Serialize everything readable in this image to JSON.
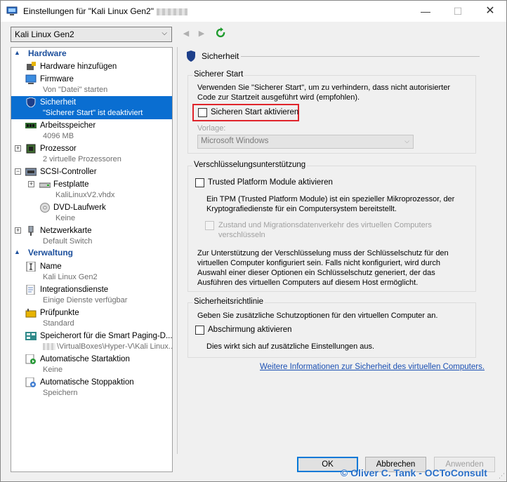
{
  "window": {
    "title": "Einstellungen für \"Kali Linux Gen2\"",
    "controls": {
      "minimize": "—",
      "maximize": "☐",
      "close": "✕"
    }
  },
  "vm_selector": {
    "value": "Kali Linux Gen2"
  },
  "tree": {
    "hardware_header": "Hardware",
    "management_header": "Verwaltung",
    "items": [
      {
        "icon": "hardware-add-icon",
        "label": "Hardware hinzufügen",
        "sub": ""
      },
      {
        "icon": "firmware-icon",
        "label": "Firmware",
        "sub": "Von \"Datei\" starten"
      },
      {
        "icon": "shield-icon",
        "label": "Sicherheit",
        "sub": "\"Sicherer Start\" ist deaktiviert"
      },
      {
        "icon": "memory-icon",
        "label": "Arbeitsspeicher",
        "sub": "4096 MB"
      },
      {
        "icon": "processor-icon",
        "label": "Prozessor",
        "sub": "2 virtuelle Prozessoren"
      },
      {
        "icon": "scsi-controller-icon",
        "label": "SCSI-Controller",
        "sub": ""
      },
      {
        "icon": "hard-disk-icon",
        "label": "Festplatte",
        "sub": "KaliLinuxV2.vhdx"
      },
      {
        "icon": "dvd-drive-icon",
        "label": "DVD-Laufwerk",
        "sub": "Keine"
      },
      {
        "icon": "network-adapter-icon",
        "label": "Netzwerkkarte",
        "sub": "Default Switch"
      },
      {
        "icon": "name-icon",
        "label": "Name",
        "sub": "Kali Linux Gen2"
      },
      {
        "icon": "integration-services-icon",
        "label": "Integrationsdienste",
        "sub": "Einige Dienste verfügbar"
      },
      {
        "icon": "checkpoints-icon",
        "label": "Prüfpunkte",
        "sub": "Standard"
      },
      {
        "icon": "smart-paging-icon",
        "label": "Speicherort für die Smart Paging-D...",
        "sub": "\\VirtualBoxes\\Hyper-V\\Kali Linux..."
      },
      {
        "icon": "auto-start-icon",
        "label": "Automatische Startaktion",
        "sub": "Keine"
      },
      {
        "icon": "auto-stop-icon",
        "label": "Automatische Stoppaktion",
        "sub": "Speichern"
      }
    ]
  },
  "content": {
    "header": "Sicherheit",
    "secure_boot": {
      "title": "Sicherer Start",
      "description_line1": "Verwenden Sie \"Sicherer Start\", um zu verhindern, dass nicht autorisierter",
      "description_line2": "Code zur Startzeit ausgeführt wird (empfohlen).",
      "checkbox_label": "Sicheren Start aktivieren",
      "checked": false,
      "template_label": "Vorlage:",
      "template_value": "Microsoft Windows"
    },
    "encryption": {
      "title": "Verschlüsselungsunterstützung",
      "tpm_label": "Trusted Platform Module aktivieren",
      "tpm_checked": false,
      "tpm_desc_line1": "Ein TPM (Trusted Platform Module) ist ein spezieller Mikroprozessor, der",
      "tpm_desc_line2": "Kryptografiedienste für ein Computersystem bereitstellt.",
      "migration_label_line1": "Zustand und Migrationsdatenverkehr des virtuellen Computers",
      "migration_label_line2": "verschlüsseln",
      "note_line1": "Zur Unterstützung der Verschlüsselung muss der Schlüsselschutz für den",
      "note_line2": "virtuellen Computer konfiguriert sein. Falls nicht konfiguriert, wird durch",
      "note_line3": "Auswahl einer dieser Optionen ein Schlüsselschutz generiert, der das",
      "note_line4": "Ausführen des virtuellen Computers auf diesem Host ermöglicht."
    },
    "policy": {
      "title": "Sicherheitsrichtlinie",
      "description": "Geben Sie zusätzliche Schutzoptionen für den virtuellen Computer an.",
      "shielding_label": "Abschirmung aktivieren",
      "shielding_checked": false,
      "shielding_note": "Dies wirkt sich auf zusätzliche Einstellungen aus."
    },
    "more_info_link": "Weitere Informationen zur Sicherheit des virtuellen Computers."
  },
  "buttons": {
    "ok": "OK",
    "cancel": "Abbrechen",
    "apply": "Anwenden"
  },
  "watermark": "© Oliver C. Tank - OCToConsult",
  "colors": {
    "selection": "#0a6ed1",
    "header_blue": "#1c4f9c",
    "highlight_red": "#e0242b",
    "link": "#1a4fb3"
  }
}
